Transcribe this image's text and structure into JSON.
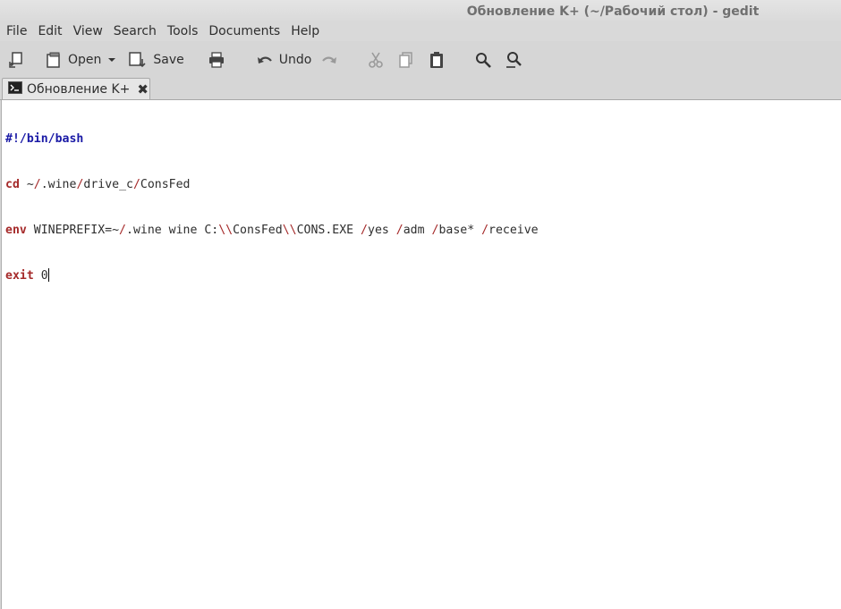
{
  "window": {
    "title": "Обновление K+ (~/Рабочий стол) - gedit"
  },
  "menu": [
    "File",
    "Edit",
    "View",
    "Search",
    "Tools",
    "Documents",
    "Help"
  ],
  "toolbar": {
    "open_label": "Open",
    "save_label": "Save",
    "undo_label": "Undo"
  },
  "tab": {
    "label": "Обновление K+",
    "close": "✖"
  },
  "editor": {
    "lines": {
      "l1": "#!/bin/bash",
      "l2_kw": "cd",
      "l2_a": " ~",
      "l2_b": "/",
      "l2_c": ".wine",
      "l2_d": "/",
      "l2_e": "drive_c",
      "l2_f": "/",
      "l2_g": "ConsFed",
      "l3_kw": "env",
      "l3_a": " WINEPREFIX=~",
      "l3_b": "/",
      "l3_c": ".wine wine C:",
      "l3_d": "\\\\",
      "l3_e": "ConsFed",
      "l3_f": "\\\\",
      "l3_g": "CONS.EXE ",
      "l3_h": "/",
      "l3_i": "yes ",
      "l3_j": "/",
      "l3_k": "adm ",
      "l3_l": "/",
      "l3_m": "base* ",
      "l3_n": "/",
      "l3_o": "receive",
      "l4_kw": "exit",
      "l4_a": " 0"
    }
  }
}
